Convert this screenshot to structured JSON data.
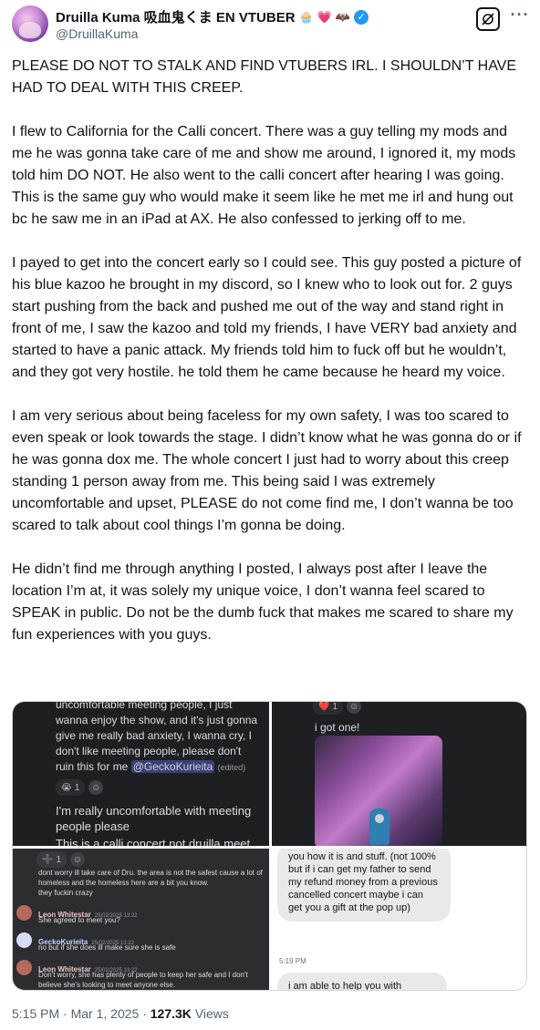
{
  "user": {
    "display_name": "Druilla Kuma 吸血鬼くま EN VTUBER",
    "emojis": [
      "🧁",
      "💗",
      "🦇"
    ],
    "handle": "@DruillaKuma",
    "verified_mark": "✓"
  },
  "header_icons": {
    "grok": "grok-icon",
    "more": "···"
  },
  "tweet": {
    "paragraphs": [
      "PLEASE DO NOT TO STALK AND FIND VTUBERS IRL. I SHOULDN’T HAVE HAD TO DEAL WITH THIS CREEP.",
      "I flew to California for the Calli concert. There was a guy telling my mods and me he was gonna take care of me and show me around, I ignored it, my mods told him DO NOT. He also went to the calli concert after hearing I was going. This is the same guy who would make it seem like he met me irl and hung out bc he saw me in an iPad at AX. He also confessed to jerking off to me.",
      "I payed to get into the concert early so I could see. This guy posted a picture of his blue kazoo he brought in my discord, so I knew who to look out for. 2 guys start pushing from the back and pushed me out of the way and stand right in front of me, I saw the kazoo and told my friends, I have VERY bad anxiety and started to have a panic attack. My friends told him to fuck off but he wouldn’t, and they got very hostile. he told them he came because he heard my voice.",
      "I am very serious about being faceless for my own safety, I was too scared to even speak or look towards the stage. I didn’t know what he was gonna do or if he was gonna dox me. The whole concert I just had to worry about this creep standing 1 person away from me. This being said I was extremely uncomfortable and upset, PLEASE do not come find me, I don’t wanna be too scared to talk about cool things I’m gonna be doing.",
      "He didn’t find me through anything I posted, I always post after I leave the location I’m at, it was solely my unique voice, I don’t wanna feel scared to SPEAK in public. Do not be the dumb fuck that makes me scared to share my fun experiences with you guys."
    ]
  },
  "media": {
    "img1": {
      "message": "uncomfortable meeting people, I just wanna enjoy the show, and it's just gonna give me really bad anxiety, I wanna cry, I don't like meeting people, please don't ruin this for me",
      "mention": "@GeckoKurieita",
      "edited": "(edited)",
      "reaction_emoji": "😭",
      "reaction_count": "1",
      "message2": "I'm really uncomfortable with meeting people please",
      "message3": "This is a calli concert not druilla meet"
    },
    "img2": {
      "reaction_emoji": "❤️",
      "reaction_count": "1",
      "message": "i got one!"
    },
    "img3": {
      "reaction_emoji": "➕",
      "reaction_count": "1",
      "message1": "dont worry ill take care of Dru. the area is not the safest cause a lot of homeless and the homeless here are a bit you know.",
      "message2": "they fuckin crazy",
      "posts": [
        {
          "author": "Leon Whitestar",
          "time": "25/02/2025 13:22",
          "text": "She agreed to meet you?"
        },
        {
          "author": "GeckoKurieita",
          "time": "25/02/2025 13:22",
          "text": "no but if she does ill make sure she is safe"
        },
        {
          "author": "Leon Whitestar",
          "time": "25/02/2025 13:22",
          "text": "Don't worry, she has plenty of people to keep her safe and I don't believe she's looking to meet anyone else."
        }
      ]
    },
    "img4": {
      "bubble1": "you how it is and stuff. (not 100% but if i can get my father to send my refund money from a previous cancelled concert maybe i can get you a gift at the pop up)",
      "time": "5:19 PM",
      "bubble2": "i am able to help you with"
    }
  },
  "footer": {
    "time": "5:15 PM",
    "date": "Mar 1, 2025",
    "views_count": "127.3K",
    "views_label": "Views"
  }
}
